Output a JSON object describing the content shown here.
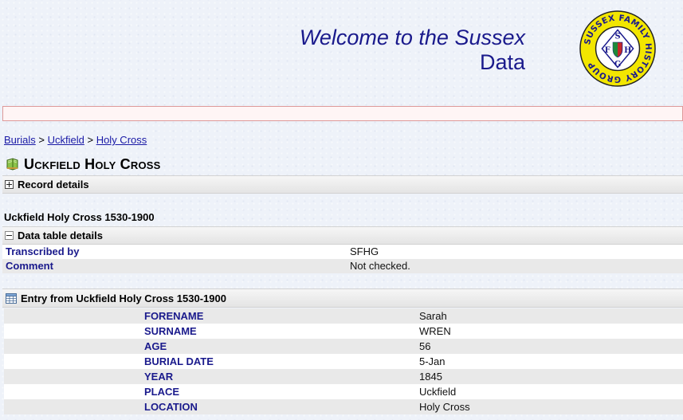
{
  "header": {
    "welcome_line1": "Welcome to the Sussex",
    "welcome_line2": "Data",
    "logo": {
      "text": "SUSSEX FAMILY HISTORY GROUP",
      "letters": [
        "S",
        "F",
        "H",
        "G"
      ],
      "ring_color": "#f2e600",
      "accent_color": "#1a1a8c"
    }
  },
  "breadcrumb": [
    "Burials",
    "Uckfield",
    "Holy Cross"
  ],
  "page_title": "Uckfield Holy Cross",
  "record_details_label": "Record details",
  "dataset_title": "Uckfield Holy Cross 1530-1900",
  "data_table": {
    "label": "Data table details",
    "rows": [
      {
        "key": "Transcribed by",
        "value": "SFHG"
      },
      {
        "key": "Comment",
        "value": "Not checked."
      }
    ]
  },
  "entry": {
    "label": "Entry from Uckfield Holy Cross 1530-1900",
    "rows": [
      {
        "key": "FORENAME",
        "value": "Sarah"
      },
      {
        "key": "SURNAME",
        "value": "WREN"
      },
      {
        "key": "AGE",
        "value": "56"
      },
      {
        "key": "BURIAL DATE",
        "value": "5-Jan"
      },
      {
        "key": "YEAR",
        "value": "1845"
      },
      {
        "key": "PLACE",
        "value": "Uckfield"
      },
      {
        "key": "LOCATION",
        "value": "Holy Cross"
      }
    ]
  }
}
